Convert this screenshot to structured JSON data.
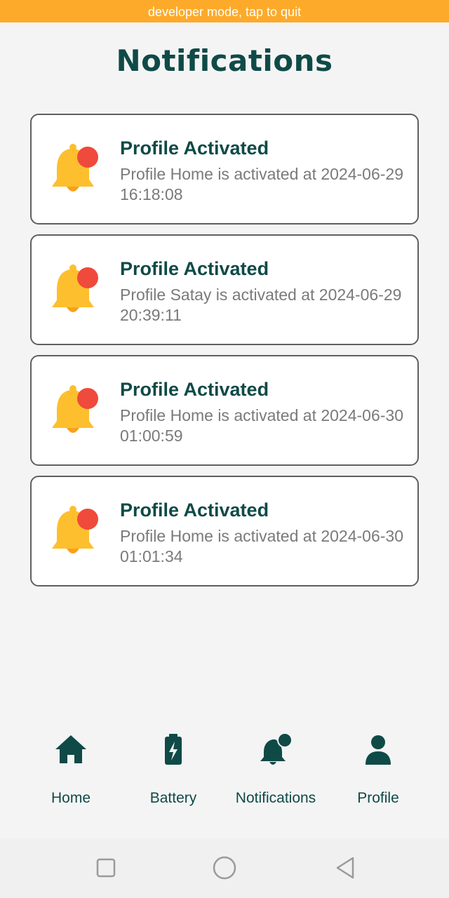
{
  "status_banner": "developer mode, tap to quit",
  "page_title": "Notifications",
  "notifications": [
    {
      "title": "Profile Activated",
      "message": "Profile Home is activated at 2024-06-29 16:18:08"
    },
    {
      "title": "Profile Activated",
      "message": "Profile Satay is activated at 2024-06-29 20:39:11"
    },
    {
      "title": "Profile Activated",
      "message": "Profile Home is activated at 2024-06-30 01:00:59"
    },
    {
      "title": "Profile Activated",
      "message": "Profile Home is activated at 2024-06-30 01:01:34"
    }
  ],
  "tabs": [
    {
      "label": "Home",
      "icon": "home-icon"
    },
    {
      "label": "Battery",
      "icon": "battery-icon"
    },
    {
      "label": "Notifications",
      "icon": "notification-bell-icon"
    },
    {
      "label": "Profile",
      "icon": "user-icon"
    }
  ],
  "system_nav": [
    "recent-apps-icon",
    "home-circle-icon",
    "back-icon"
  ],
  "colors": {
    "banner": "#fdaa2a",
    "primary": "#0f4a47",
    "bell": "#fdbf2d",
    "bell_badge": "#ef4a3c",
    "muted_text": "#7a7a7a"
  }
}
